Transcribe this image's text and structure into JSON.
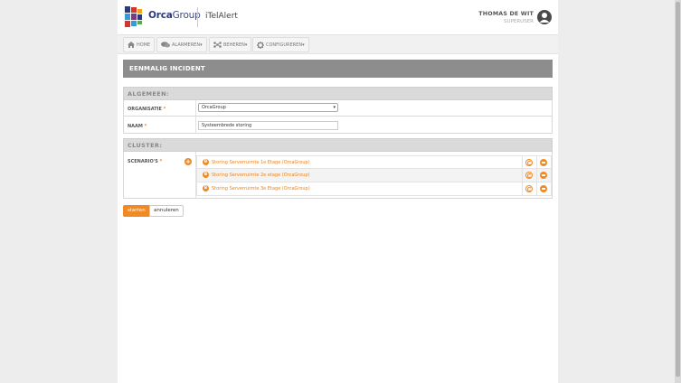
{
  "header": {
    "logo_bold": "Orca",
    "logo_light": "Group",
    "app_title": "iTelAlert",
    "user_name": "THOMAS DE WIT",
    "user_role": "SUPERUSER"
  },
  "nav": {
    "items": [
      {
        "label": "HOME",
        "icon": "home-icon"
      },
      {
        "label": "ALARMEREN",
        "icon": "chat-bubbles-icon",
        "dropdown": true
      },
      {
        "label": "BEHEREN",
        "icon": "network-icon",
        "dropdown": true
      },
      {
        "label": "CONFIGUREREN",
        "icon": "gear-icon",
        "dropdown": true
      }
    ]
  },
  "page": {
    "title": "EENMALIG INCIDENT"
  },
  "general": {
    "heading": "ALGEMEEN:",
    "org_label": "ORGANISATIE",
    "org_value": "OrcaGroup",
    "name_label": "NAAM",
    "name_value": "Systeembrede storing",
    "required_marker": "*"
  },
  "cluster": {
    "heading": "CLUSTER:",
    "scenarios_label": "SCENARIO'S",
    "scenarios": [
      {
        "badge": "B",
        "text": "Storing Serverruimte 1e Etage (OrcaGroup)"
      },
      {
        "badge": "B",
        "text": "Storing Serverruimte 2e etage (OrcaGroup)"
      },
      {
        "badge": "B",
        "text": "Storing Serverruimte 3e Etage (OrcaGroup)"
      }
    ]
  },
  "actions": {
    "start": "starten",
    "cancel": "annuleren"
  },
  "colors": {
    "accent": "#f08a24",
    "title_bar": "#8d8d8d",
    "section_head": "#dadada"
  }
}
